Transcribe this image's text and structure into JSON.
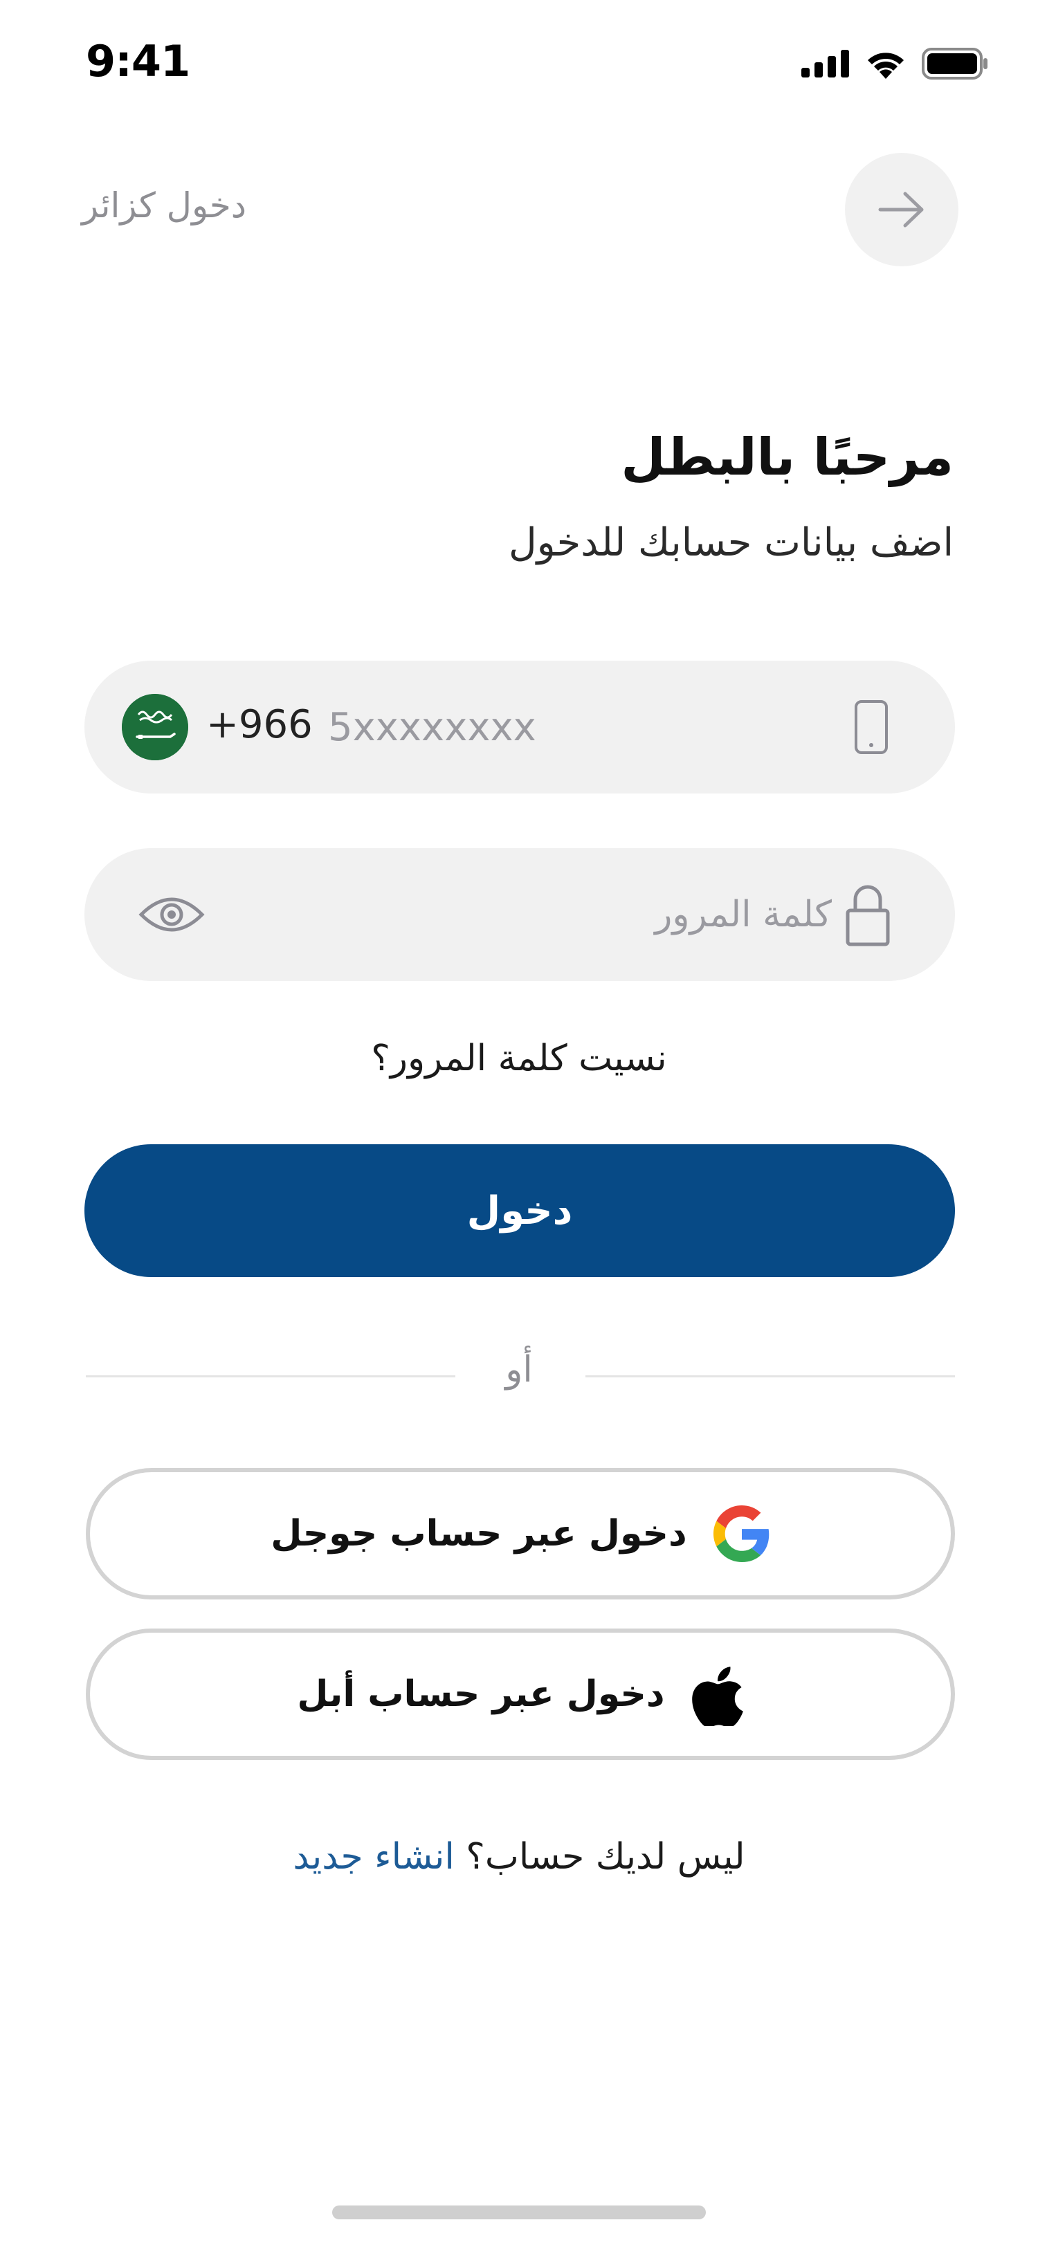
{
  "status_bar": {
    "time": "9:41"
  },
  "header": {
    "guest_login": "دخول كزائر"
  },
  "welcome": {
    "title": "مرحبًا بالبطل",
    "subtitle": "اضف بيانات حسابك للدخول"
  },
  "phone": {
    "country_code": "+966",
    "placeholder": "5xxxxxxxx",
    "value": ""
  },
  "password": {
    "placeholder": "كلمة المرور",
    "value": ""
  },
  "forgot_password": "نسيت كلمة المرور؟",
  "login_button": "دخول",
  "divider": "أو",
  "social": {
    "google_label": "دخول عبر حساب جوجل",
    "apple_label": "دخول عبر حساب أبل"
  },
  "signup": {
    "prompt": "ليس لديك حساب؟",
    "link": "انشاء جديد"
  },
  "colors": {
    "primary": "#074a86",
    "field_bg": "#f1f1f1",
    "link": "#1d5b96",
    "flag_green": "#1c6f3b"
  },
  "icons": {
    "back": "arrow-right-icon",
    "phone": "smartphone-icon",
    "password": "lock-icon",
    "visibility": "eye-icon",
    "country": "saudi-flag-icon",
    "google": "google-logo-icon",
    "apple": "apple-logo-icon"
  }
}
